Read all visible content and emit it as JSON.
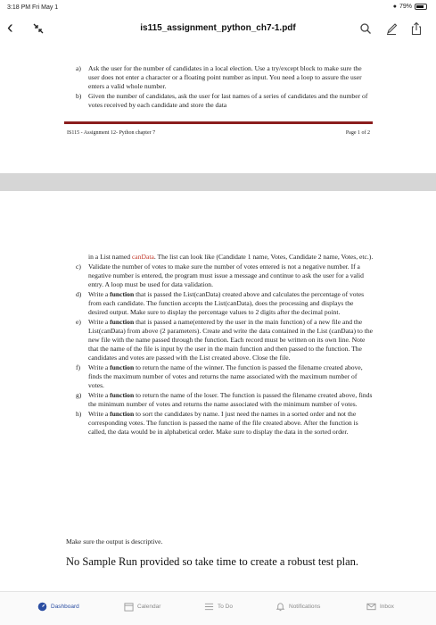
{
  "status": {
    "time": "3:18 PM  Fri May 1",
    "battery": "79%",
    "battery_fraction": 0.79
  },
  "toolbar": {
    "title": "is115_assignment_python_ch7-1.pdf"
  },
  "page1": {
    "items": [
      {
        "label": "a)",
        "text": "Ask the user for the number of candidates in a local election. Use a try/except block to make sure the user does not enter a character or a floating point number as input. You need a loop to assure the user enters a valid whole number."
      },
      {
        "label": "b)",
        "text": "Given the number of candidates, ask the user for last names of a series of candidates and the number of votes received by each candidate and store the data"
      }
    ],
    "footer_left": "IS115 - Assignment 12- Python chapter 7",
    "footer_right": "Page 1 of 2"
  },
  "page2": {
    "cont_pre": "in a List named ",
    "cont_red": "canData",
    "cont_post": ". The list can look like (Candidate 1 name, Votes, Candidate 2 name, Votes, etc.).",
    "items": [
      {
        "label": "c)",
        "pre": "",
        "bold": "",
        "text": "Validate the number of votes to make sure the number of votes entered is not a negative number. If a negative number is entered, the program must issue a message and continue to ask the user for a valid entry. A loop must be used for data validation."
      },
      {
        "label": "d)",
        "pre": "Write a ",
        "bold": "function",
        "text": " that is passed the List(canData) created above and calculates the percentage of votes from each candidate. The function accepts the List(canData), does the processing and displays the desired output. Make sure to display the percentage values to 2 digits after the decimal point."
      },
      {
        "label": "e)",
        "pre": "Write a ",
        "bold": "function",
        "text": " that is passed a name(entered by the user in the main function) of a new file and the List(canData) from above (2 parameters). Create and write the data contained in the List (canData) to the new file with the name passed through the function. Each record must be written on its own line. Note that the name of the file is input by the user in the main function and then passed to the function. The candidates and votes are passed with the List created above. Close the file."
      },
      {
        "label": "f)",
        "pre": "Write a ",
        "bold": "function",
        "text": " to return the name of the winner. The function is passed the filename created above, finds the maximum number of votes and returns the name associated with the maximum number of votes."
      },
      {
        "label": "g)",
        "pre": "Write a ",
        "bold": "function",
        "text": " to return the name of the loser. The function is passed the filename created above, finds the minimum number of votes and returns the name associated with the minimum number of votes."
      },
      {
        "label": "h)",
        "pre": "Write a ",
        "bold": "function",
        "text": " to sort the candidates by name. I just need the names in a sorted order and not the corresponding votes. The function is passed the name of the file created above. After the function is called, the data would be in alphabetical order. Make sure to display the data in the sorted order."
      }
    ],
    "note": "Make sure the output is descriptive.",
    "big_note": "No Sample Run provided so take time to create a robust test plan."
  },
  "tabbar": {
    "tabs": [
      "Dashboard",
      "Calendar",
      "To Do",
      "Notifications",
      "Inbox"
    ]
  }
}
